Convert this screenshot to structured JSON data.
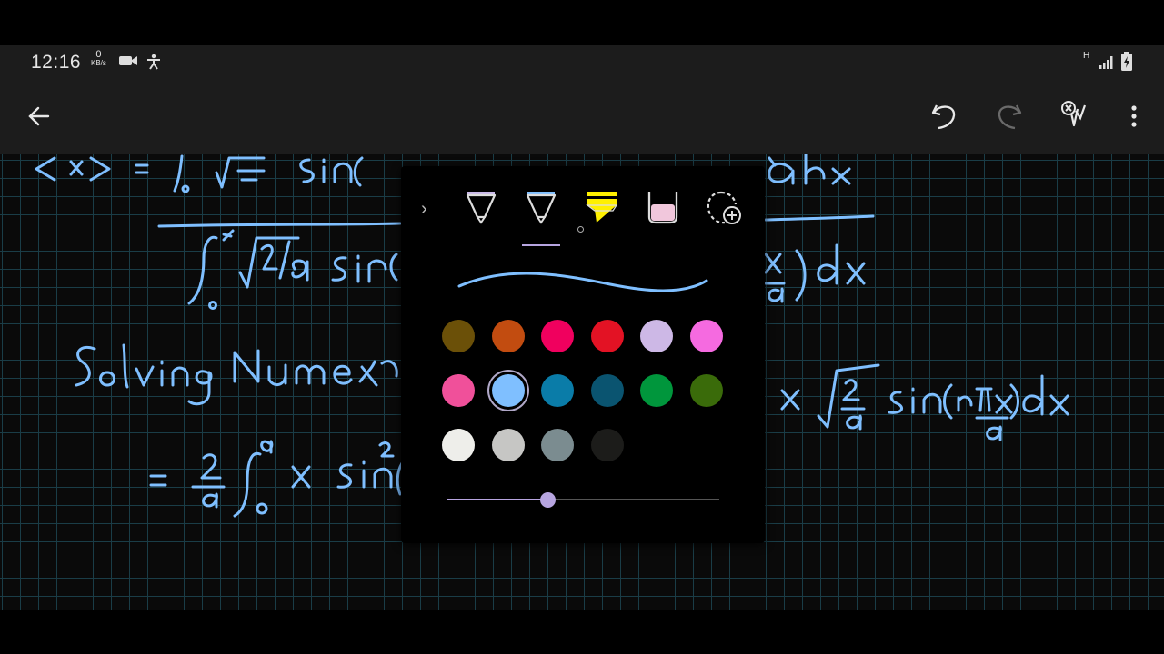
{
  "status_bar": {
    "time": "12:16",
    "net_speed_value": "0",
    "net_speed_unit": "KB/s",
    "network_letter": "H",
    "icons": [
      "video-camera-icon",
      "accessibility-icon",
      "signal-icon",
      "battery-icon"
    ]
  },
  "toolbar": {
    "icons": [
      "back-arrow-icon",
      "undo-icon",
      "redo-icon",
      "pen-eraser-icon",
      "more-vert-icon"
    ]
  },
  "pen_panel": {
    "tools": [
      "pen-purple-icon",
      "pen-blue-icon",
      "highlighter-yellow-icon",
      "marker-pink-icon",
      "add-pen-icon"
    ],
    "selected_tool": 1,
    "stroke_color": "#7fbfff",
    "swatches": [
      "#6b5008",
      "#c24c10",
      "#f0005e",
      "#e31224",
      "#cdb8e6",
      "#f56ae0",
      "#f0509a",
      "#7fbfff",
      "#0a7ca8",
      "#0a5470",
      "#00963c",
      "#3a6b0a",
      "#eeeeea",
      "#c6c6c4",
      "#7b8c90",
      "#1c1c1a"
    ],
    "selected_swatch": 7,
    "thickness": 0.37
  }
}
